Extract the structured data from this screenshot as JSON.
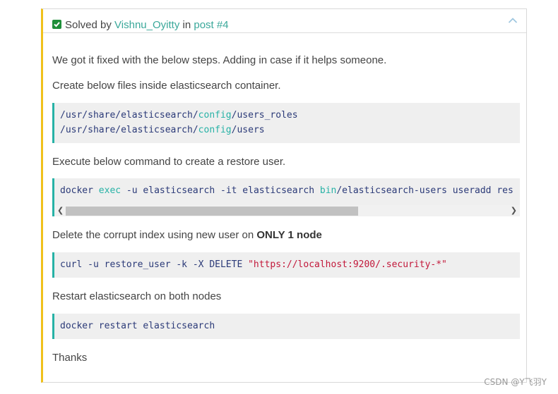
{
  "header": {
    "solved_prefix": "Solved by",
    "author": "Vishnu_Oyitty",
    "in_word": "in",
    "post_link": "post #4",
    "collapse_icon": "chevron-up-icon",
    "check_icon": "check-square-icon"
  },
  "body": {
    "p1": "We got it fixed with the below steps. Adding in case if it helps someone.",
    "p2": "Create below files inside elasticsearch container.",
    "code1": {
      "line1": {
        "a": "/usr/share/elasticsearch/",
        "kw": "config",
        "b": "/users_roles"
      },
      "line2": {
        "a": "/usr/share/elasticsearch/",
        "kw": "config",
        "b": "/users"
      }
    },
    "p3": "Execute below command to create a restore user.",
    "code2": {
      "a": "docker ",
      "kw1": "exec",
      "b": " -u elasticsearch -it elasticsearch ",
      "kw2": "bin",
      "c": "/elasticsearch-users useradd res"
    },
    "p4_prefix": "Delete the corrupt index using new user on ",
    "p4_bold": "ONLY 1 node",
    "code3": {
      "a": "curl -u restore_user -k -X DELETE ",
      "str": "\"https://localhost:9200/.security-*\""
    },
    "p5": "Restart elasticsearch on both nodes",
    "code4": {
      "a": "docker restart elasticsearch"
    },
    "p6": "Thanks"
  },
  "watermark": "CSDN @Y飞羽Y",
  "colors": {
    "accent_border": "#f0c11b",
    "link": "#3aa89a",
    "code_border": "#27b2a6",
    "check": "#1f8f3a",
    "string": "#c2183a"
  }
}
